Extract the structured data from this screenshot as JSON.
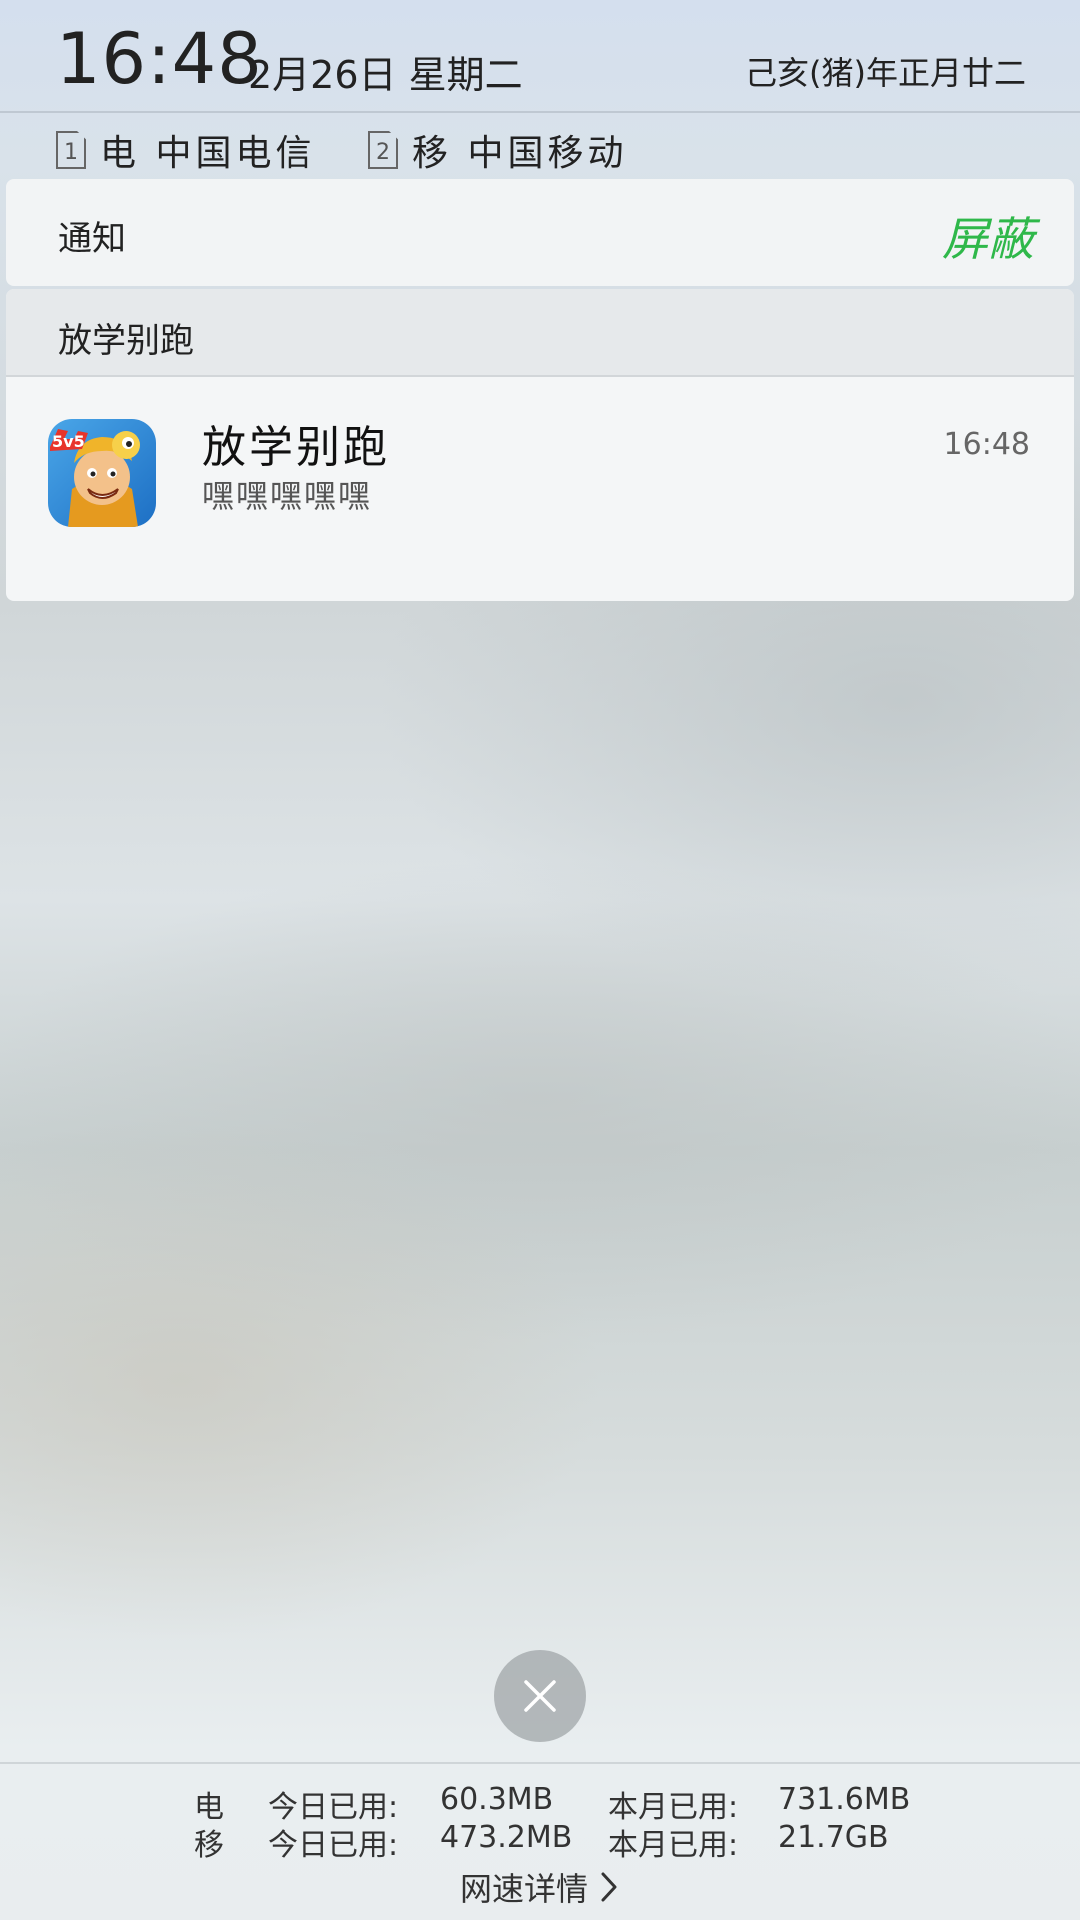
{
  "header": {
    "time": "16:48",
    "date": "2月26日 星期二",
    "lunar": "己亥(猪)年正月廿二"
  },
  "sims": [
    {
      "slot": "1",
      "label": "电 中国电信"
    },
    {
      "slot": "2",
      "label": "移 中国移动"
    }
  ],
  "notifications": {
    "header_label": "通知",
    "block_label": "屏蔽",
    "group": {
      "title": "放学别跑",
      "item": {
        "app_icon": "game-app-icon",
        "title": "放学别跑",
        "body": "嘿嘿嘿嘿嘿",
        "time": "16:48"
      }
    }
  },
  "close_button": {
    "icon": "close-icon"
  },
  "data_usage": {
    "rows": [
      {
        "sim": "电",
        "today_label": "今日已用:",
        "today_value": "60.3MB",
        "month_label": "本月已用:",
        "month_value": "731.6MB"
      },
      {
        "sim": "移",
        "today_label": "今日已用:",
        "today_value": "473.2MB",
        "month_label": "本月已用:",
        "month_value": "21.7GB"
      }
    ],
    "detail_link": "网速详情"
  },
  "colors": {
    "accent_green": "#2fb84a"
  }
}
